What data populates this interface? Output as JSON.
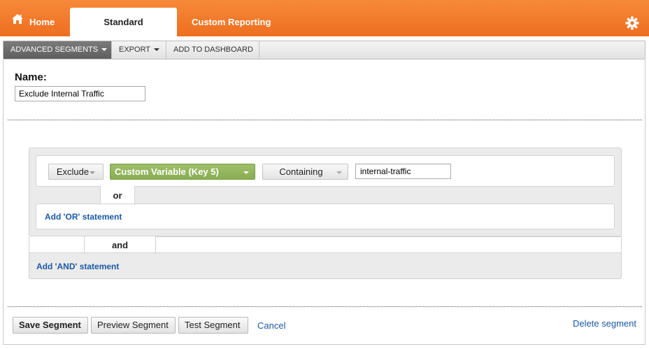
{
  "nav": {
    "home": "Home",
    "standard": "Standard Reporting",
    "custom": "Custom Reporting"
  },
  "toolbar": {
    "advanced_segments": "ADVANCED SEGMENTS",
    "export": "EXPORT",
    "add_to_dashboard": "ADD TO DASHBOARD"
  },
  "form": {
    "name_label": "Name:",
    "name_value": "Exclude Internal Traffic"
  },
  "condition": {
    "include_exclude": "Exclude",
    "dimension": "Custom Variable (Key 5)",
    "match_type": "Containing",
    "value": "internal-traffic",
    "or_label": "or",
    "add_or": "Add 'OR' statement"
  },
  "and_group": {
    "and_label": "and",
    "add_and": "Add 'AND' statement"
  },
  "footer": {
    "save": "Save Segment",
    "preview": "Preview Segment",
    "test": "Test Segment",
    "cancel": "Cancel",
    "delete": "Delete segment"
  },
  "colors": {
    "nav_orange": "#ef7528",
    "dimension_green": "#94b75d",
    "link_blue": "#1a59a5"
  },
  "icons": [
    "home-icon",
    "gear-icon",
    "caret-down-icon"
  ]
}
